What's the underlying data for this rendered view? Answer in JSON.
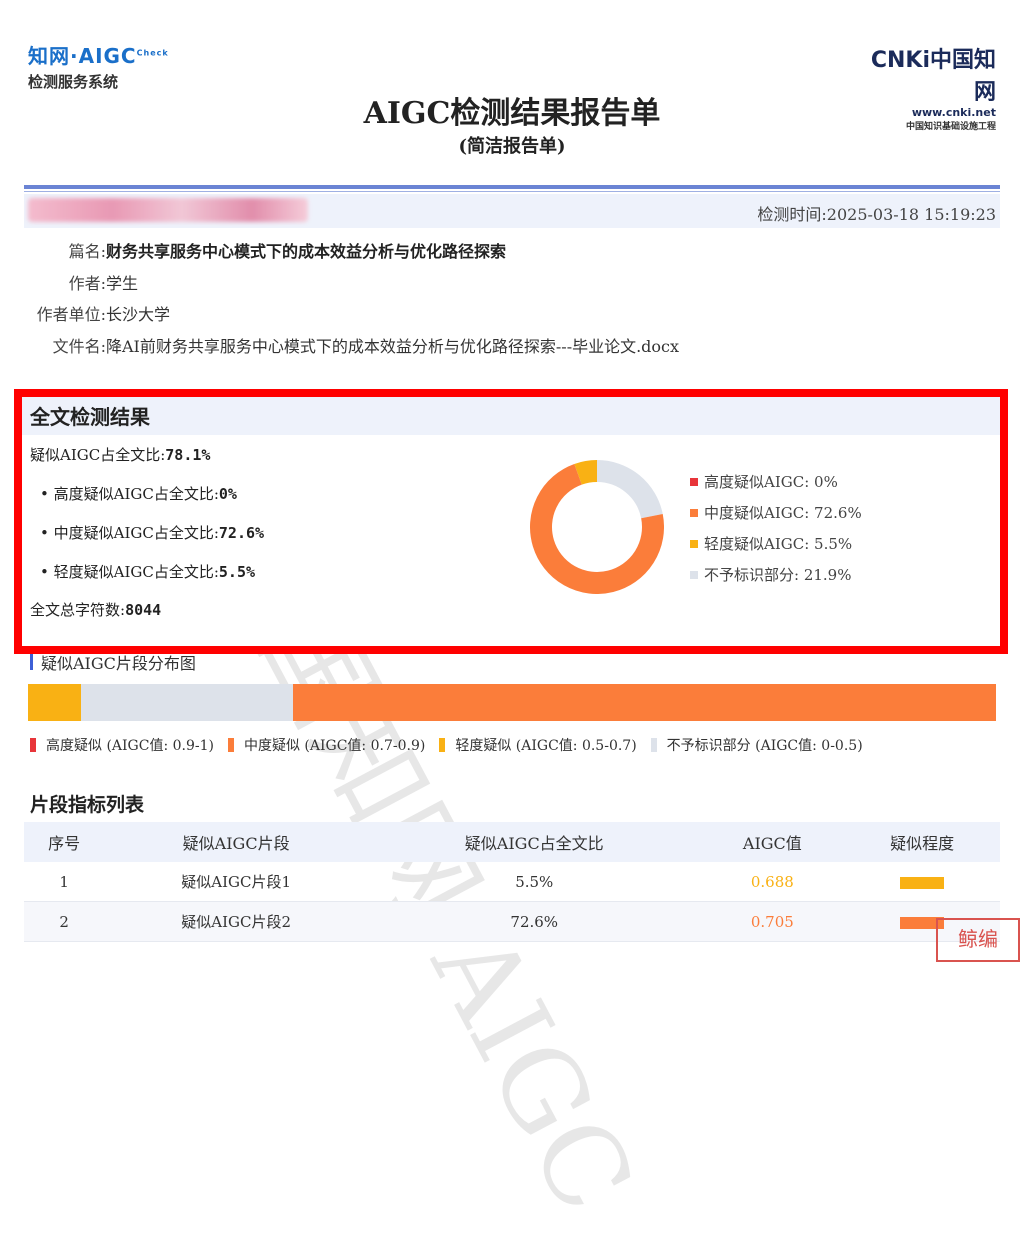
{
  "header": {
    "logo_left_line1": "知网·AIGC",
    "logo_left_sup": "Check",
    "logo_left_line2": "检测服务系统",
    "logo_right_line1": "CNKi中国知网",
    "logo_right_line2": "www.cnki.net",
    "logo_right_line3": "中国知识基础设施工程",
    "title": "AIGC检测结果报告单",
    "subtitle": "(简洁报告单)"
  },
  "info": {
    "check_time": "检测时间:2025-03-18 15:19:23",
    "rows": [
      {
        "label": "篇名:",
        "value": "财务共享服务中心模式下的成本效益分析与优化路径探索"
      },
      {
        "label": "作者:",
        "value": "学生"
      },
      {
        "label": "作者单位:",
        "value": "长沙大学"
      },
      {
        "label": "文件名:",
        "value": "降AI前财务共享服务中心模式下的成本效益分析与优化路径探索---毕业论文.docx"
      }
    ]
  },
  "result": {
    "heading": "全文检测结果",
    "total_label": "疑似AIGC占全文比:",
    "total_value": "78.1%",
    "high_label": "• 高度疑似AIGC占全文比:",
    "high_value": "0%",
    "mid_label": "• 中度疑似AIGC占全文比:",
    "mid_value": "72.6%",
    "low_label": "• 轻度疑似AIGC占全文比:",
    "low_value": "5.5%",
    "chars_label": "全文总字符数:",
    "chars_value": "8044"
  },
  "chart_data": {
    "type": "pie",
    "categories": [
      "高度疑似AIGC",
      "中度疑似AIGC",
      "轻度疑似AIGC",
      "不予标识部分"
    ],
    "values": [
      0,
      72.6,
      5.5,
      21.9
    ],
    "legend": [
      "高度疑似AIGC: 0%",
      "中度疑似AIGC: 72.6%",
      "轻度疑似AIGC: 5.5%",
      "不予标识部分: 21.9%"
    ],
    "colors": [
      "#e8353a",
      "#fb7d3a",
      "#f9b114",
      "#dde2ea"
    ],
    "legend_position": "right"
  },
  "distribution": {
    "title": "疑似AIGC片段分布图",
    "segments": [
      {
        "kind": "low",
        "fraction": 0.055,
        "color": "#f9b114"
      },
      {
        "kind": "none",
        "fraction": 0.219,
        "color": "#dde2ea"
      },
      {
        "kind": "mid",
        "fraction": 0.726,
        "color": "#fb7d3a"
      }
    ],
    "legend": [
      {
        "label": "高度疑似 (AIGC值: 0.9-1)",
        "color": "#e8353a"
      },
      {
        "label": "中度疑似 (AIGC值: 0.7-0.9)",
        "color": "#fb7d3a"
      },
      {
        "label": "轻度疑似 (AIGC值: 0.5-0.7)",
        "color": "#f9b114"
      },
      {
        "label": "不予标识部分 (AIGC值: 0-0.5)",
        "color": "#dde2ea"
      }
    ]
  },
  "table": {
    "title": "片段指标列表",
    "headers": [
      "序号",
      "疑似AIGC片段",
      "疑似AIGC占全文比",
      "AIGC值",
      "疑似程度"
    ],
    "rows": [
      {
        "index": "1",
        "name": "疑似AIGC片段1",
        "ratio": "5.5%",
        "aigc": "0.688",
        "aigc_color": "#f9b114",
        "degree_color": "#f9b114"
      },
      {
        "index": "2",
        "name": "疑似AIGC片段2",
        "ratio": "72.6%",
        "aigc": "0.705",
        "aigc_color": "#fb7d3a",
        "degree_color": "#fb7d3a"
      }
    ]
  },
  "watermark": "中国知网 AIGC",
  "corner_seal": "鲸编"
}
